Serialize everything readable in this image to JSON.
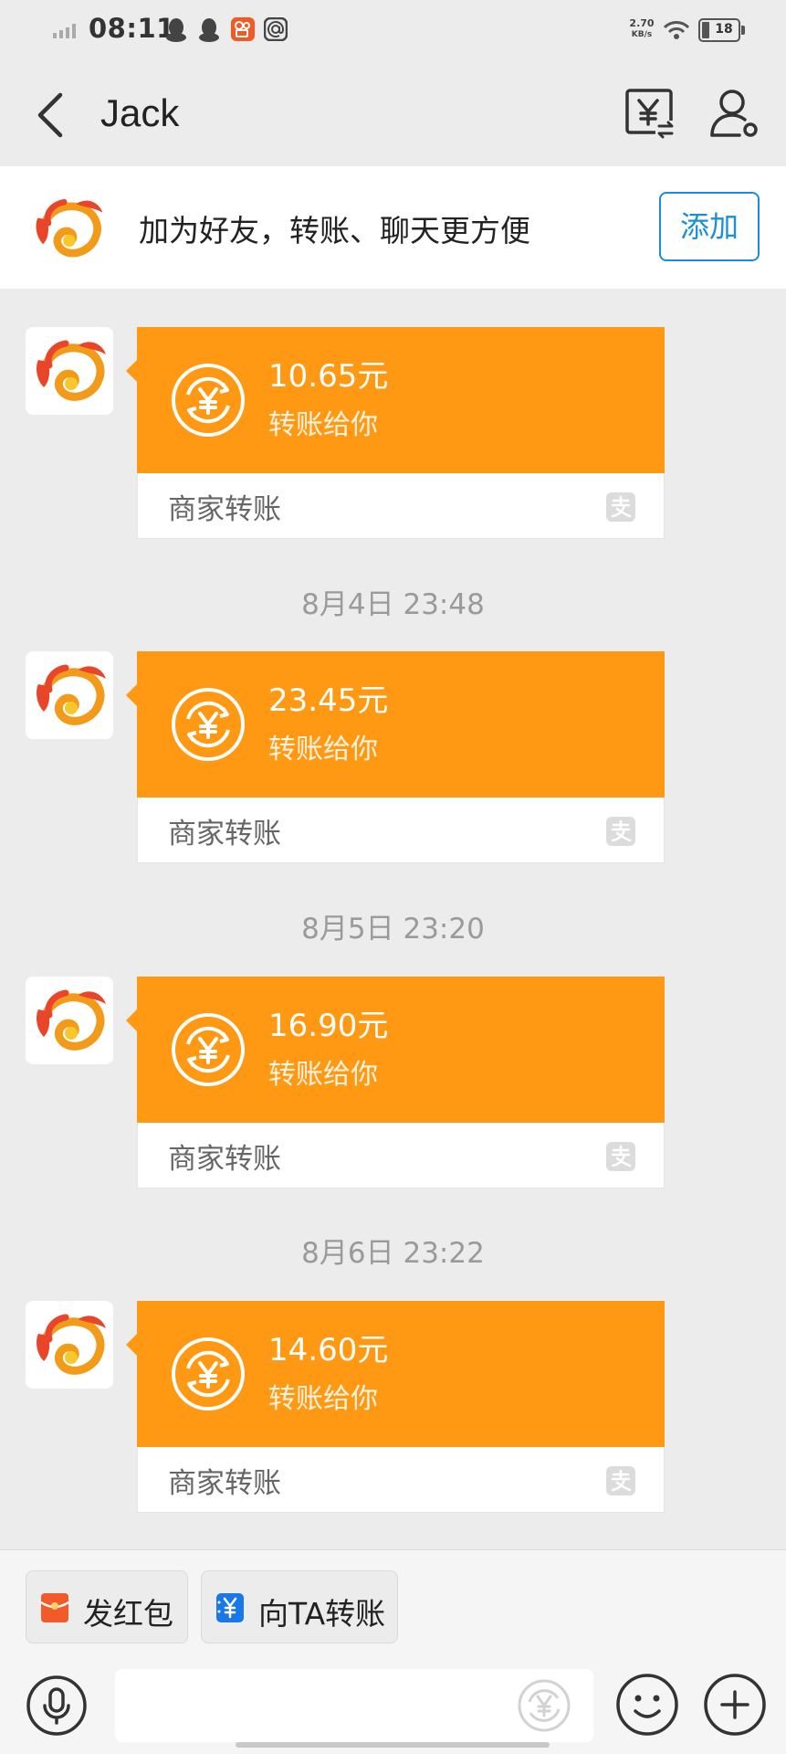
{
  "status_bar": {
    "time": "08:11",
    "speed_value": "2.70",
    "speed_unit": "KB/s",
    "battery": "18",
    "notification_icons": [
      "qq-icon",
      "qq-icon",
      "kuaishou-icon",
      "at-icon"
    ]
  },
  "header": {
    "title": "Jack",
    "back_icon": "chevron-left-icon",
    "transfer_icon": "yuan-transfer-icon",
    "profile_icon": "person-settings-icon"
  },
  "banner": {
    "text": "加为好友，转账、聊天更方便",
    "add_label": "添加"
  },
  "messages": [
    {
      "amount": "10.65元",
      "subtitle": "转账给你",
      "label": "商家转账"
    },
    {
      "timestamp": "8月4日 23:48",
      "amount": "23.45元",
      "subtitle": "转账给你",
      "label": "商家转账"
    },
    {
      "timestamp": "8月5日 23:20",
      "amount": "16.90元",
      "subtitle": "转账给你",
      "label": "商家转账"
    },
    {
      "timestamp": "8月6日 23:22",
      "amount": "14.60元",
      "subtitle": "转账给你",
      "label": "商家转账"
    }
  ],
  "bottom_bar": {
    "red_packet_label": "发红包",
    "transfer_label": "向TA转账",
    "input_value": "",
    "icons": [
      "mic-icon",
      "yuan-coin-icon",
      "smiley-icon",
      "plus-icon"
    ]
  },
  "colors": {
    "card_orange": "#ff9812",
    "accent_blue": "#1a8fd6",
    "background": "#ececec"
  }
}
